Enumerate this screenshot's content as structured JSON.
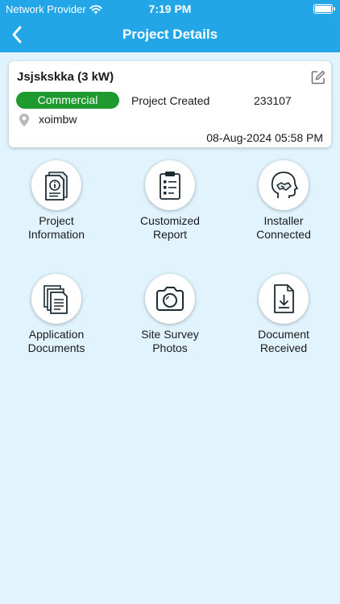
{
  "status_bar": {
    "carrier": "Network Provider",
    "time": "7:19 PM"
  },
  "header": {
    "title": "Project Details"
  },
  "project": {
    "name": "Jsjskskka (3 kW)",
    "category": "Commercial",
    "status": "Project Created",
    "id": "233107",
    "location": "xoimbw",
    "datetime": "08-Aug-2024 05:58 PM"
  },
  "tiles": [
    {
      "line1": "Project",
      "line2": "Information",
      "icon": "info-document-icon"
    },
    {
      "line1": "Customized",
      "line2": "Report",
      "icon": "checklist-clipboard-icon"
    },
    {
      "line1": "Installer",
      "line2": "Connected",
      "icon": "handshake-head-icon"
    },
    {
      "line1": "Application",
      "line2": "Documents",
      "icon": "documents-stack-icon"
    },
    {
      "line1": "Site Survey",
      "line2": "Photos",
      "icon": "camera-icon"
    },
    {
      "line1": "Document",
      "line2": "Received",
      "icon": "download-document-icon"
    }
  ],
  "colors": {
    "header": "#23a6e8",
    "background": "#e1f4fd",
    "badge": "#1e9a2e"
  }
}
